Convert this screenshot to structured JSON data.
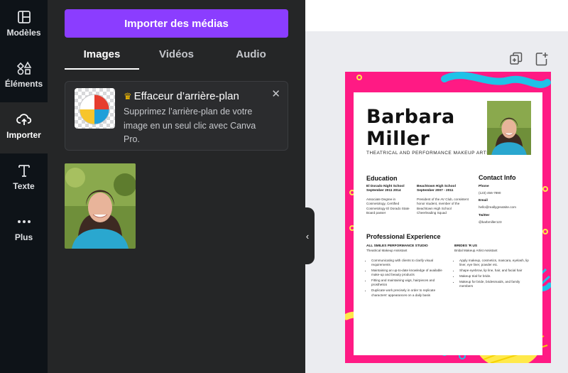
{
  "rail": {
    "items": [
      {
        "label": "Modèles",
        "icon": "templates-icon"
      },
      {
        "label": "Éléments",
        "icon": "elements-icon"
      },
      {
        "label": "Importer",
        "icon": "upload-cloud-icon"
      },
      {
        "label": "Texte",
        "icon": "text-icon"
      },
      {
        "label": "Plus",
        "icon": "more-icon"
      }
    ]
  },
  "panel": {
    "import_button": "Importer des médias",
    "tabs": [
      {
        "label": "Images",
        "active": true
      },
      {
        "label": "Vidéos",
        "active": false
      },
      {
        "label": "Audio",
        "active": false
      }
    ],
    "promo": {
      "title": "Effaceur d’arrière-plan",
      "description": "Supprimez l’arrière-plan de votre image en un seul clic avec Canva Pro.",
      "close": "✕"
    }
  },
  "canvas": {
    "collapse": "‹"
  },
  "resume": {
    "first_name": "Barbara",
    "last_name": "Miller",
    "job_title": "THEATRICAL AND PERFORMANCE MAKEUP ARTIST",
    "education_heading": "Education",
    "edu1_school": "El Dorado Night School",
    "edu1_dates": "September 2011 2014",
    "edu1_desc": "Associate Degree in Cosmetology, Certified Cosmetology El Dorado State Board passer",
    "edu2_school": "Beachtown High School",
    "edu2_dates": "September 2007 - 2011",
    "edu2_desc": "President of the AV Club, consistent honor student, member of the Beachtown High School Cheerleading Squad",
    "contact_heading": "Contact Info",
    "phone_label": "Phone",
    "phone": "(123) 456-7890",
    "email_label": "Email",
    "email": "hello@reallygreatsite.com",
    "twitter_label": "Twitter",
    "twitter": "@barbmiller123",
    "experience_heading": "Professional Experience",
    "job1_company": "ALL SMILES PERFORMANCE STUDIO",
    "job1_role": "Theatrical Makeup Assistant",
    "job1_bullets": [
      "Communicating with clients to clarify visual requirements",
      "Maintaining an up-to-date knowledge of available make-up and beauty products",
      "Fitting and maintaining wigs, hairpieces and prosthetics",
      "Duplicate work precisely in order to replicate characters' appearances on a daily basis"
    ],
    "job2_company": "BRIDES 'R US",
    "job2_role": "Bridal Makeup Artist Assistant",
    "job2_bullets": [
      "Apply makeup, cosmetics, mascara, eyelash, lip liner, eye liner, powder etc.",
      "Shape eyebrow, lip line, hair, and facial hair",
      "Makeup trial for bride.",
      "Makeup for bride, bridesmaids, and family members"
    ]
  },
  "colors": {
    "accent": "#8b3dff",
    "rail_bg": "#0e1318",
    "panel_bg": "#252627",
    "resume_pink": "#ff1a84",
    "resume_blue": "#1fc2e8",
    "resume_yellow": "#ffe94a"
  }
}
